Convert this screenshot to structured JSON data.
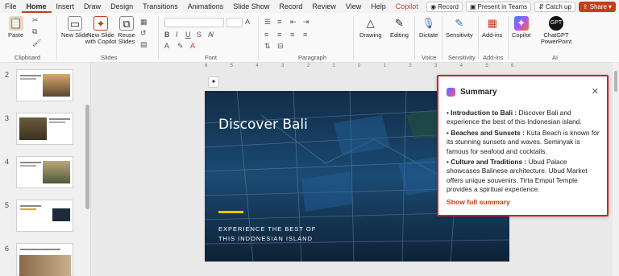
{
  "tabs": [
    "File",
    "Home",
    "Insert",
    "Draw",
    "Design",
    "Transitions",
    "Animations",
    "Slide Show",
    "Record",
    "Review",
    "View",
    "Help",
    "Copilot"
  ],
  "active_tab": "Home",
  "actions": {
    "record": "Record",
    "present_teams": "Present in Teams",
    "catch_up": "Catch up",
    "share": "Share"
  },
  "ribbon": {
    "paste": "Paste",
    "new_slide": "New Slide",
    "new_slide_copilot": "New Slide with Copilot",
    "reuse_slides": "Reuse Slides",
    "clipboard": "Clipboard",
    "slides": "Slides",
    "font": "Font",
    "paragraph": "Paragraph",
    "drawing": "Drawing",
    "editing": "Editing",
    "dictate": "Dictate",
    "voice": "Voice",
    "sensitivity": "Sensitivity",
    "addins": "Add-ins",
    "copilot": "Copilot",
    "chatgpt": "ChatGPT PowerPoint",
    "ai": "AI"
  },
  "thumbnails": [
    {
      "num": "2",
      "title": "Top 3: Beaches and Sunsets"
    },
    {
      "num": "3",
      "title": "Top 2: Culture and Traditions"
    },
    {
      "num": "4",
      "title": "Top 3: Adventure and Nature"
    },
    {
      "num": "5",
      "title": "Top 4: Cuisine and Restaurants"
    },
    {
      "num": "6",
      "title": "Top 5: Nightlife and Entertainment"
    }
  ],
  "ruler_ticks": [
    "6",
    "5",
    "4",
    "3",
    "2",
    "1",
    "0",
    "1",
    "2",
    "3",
    "4",
    "5",
    "6"
  ],
  "slide": {
    "title": "Discover Bali",
    "subtitle": "EXPERIENCE THE BEST OF\nTHIS INDONESIAN ISLAND"
  },
  "summary": {
    "heading": "Summary",
    "items": [
      {
        "label": "Introduction to Bali :",
        "text": " Discover Bali and experience the best of this Indonesian island."
      },
      {
        "label": "Beaches and Sunsets :",
        "text": " Kuta Beach is known for its stunning sunsets and waves. Seminyak is famous for seafood and cocktails."
      },
      {
        "label": "Culture and Traditions :",
        "text": " Ubud Palace showcases Balinese architecture. Ubud Market offers unique souvenirs. Tirta Empul Temple provides a spiritual experience."
      }
    ],
    "show_full": "Show full summary"
  },
  "colors": {
    "accent": "#c43e1c",
    "highlight_border": "#d61e1e",
    "slide_bar": "#f2c500"
  }
}
